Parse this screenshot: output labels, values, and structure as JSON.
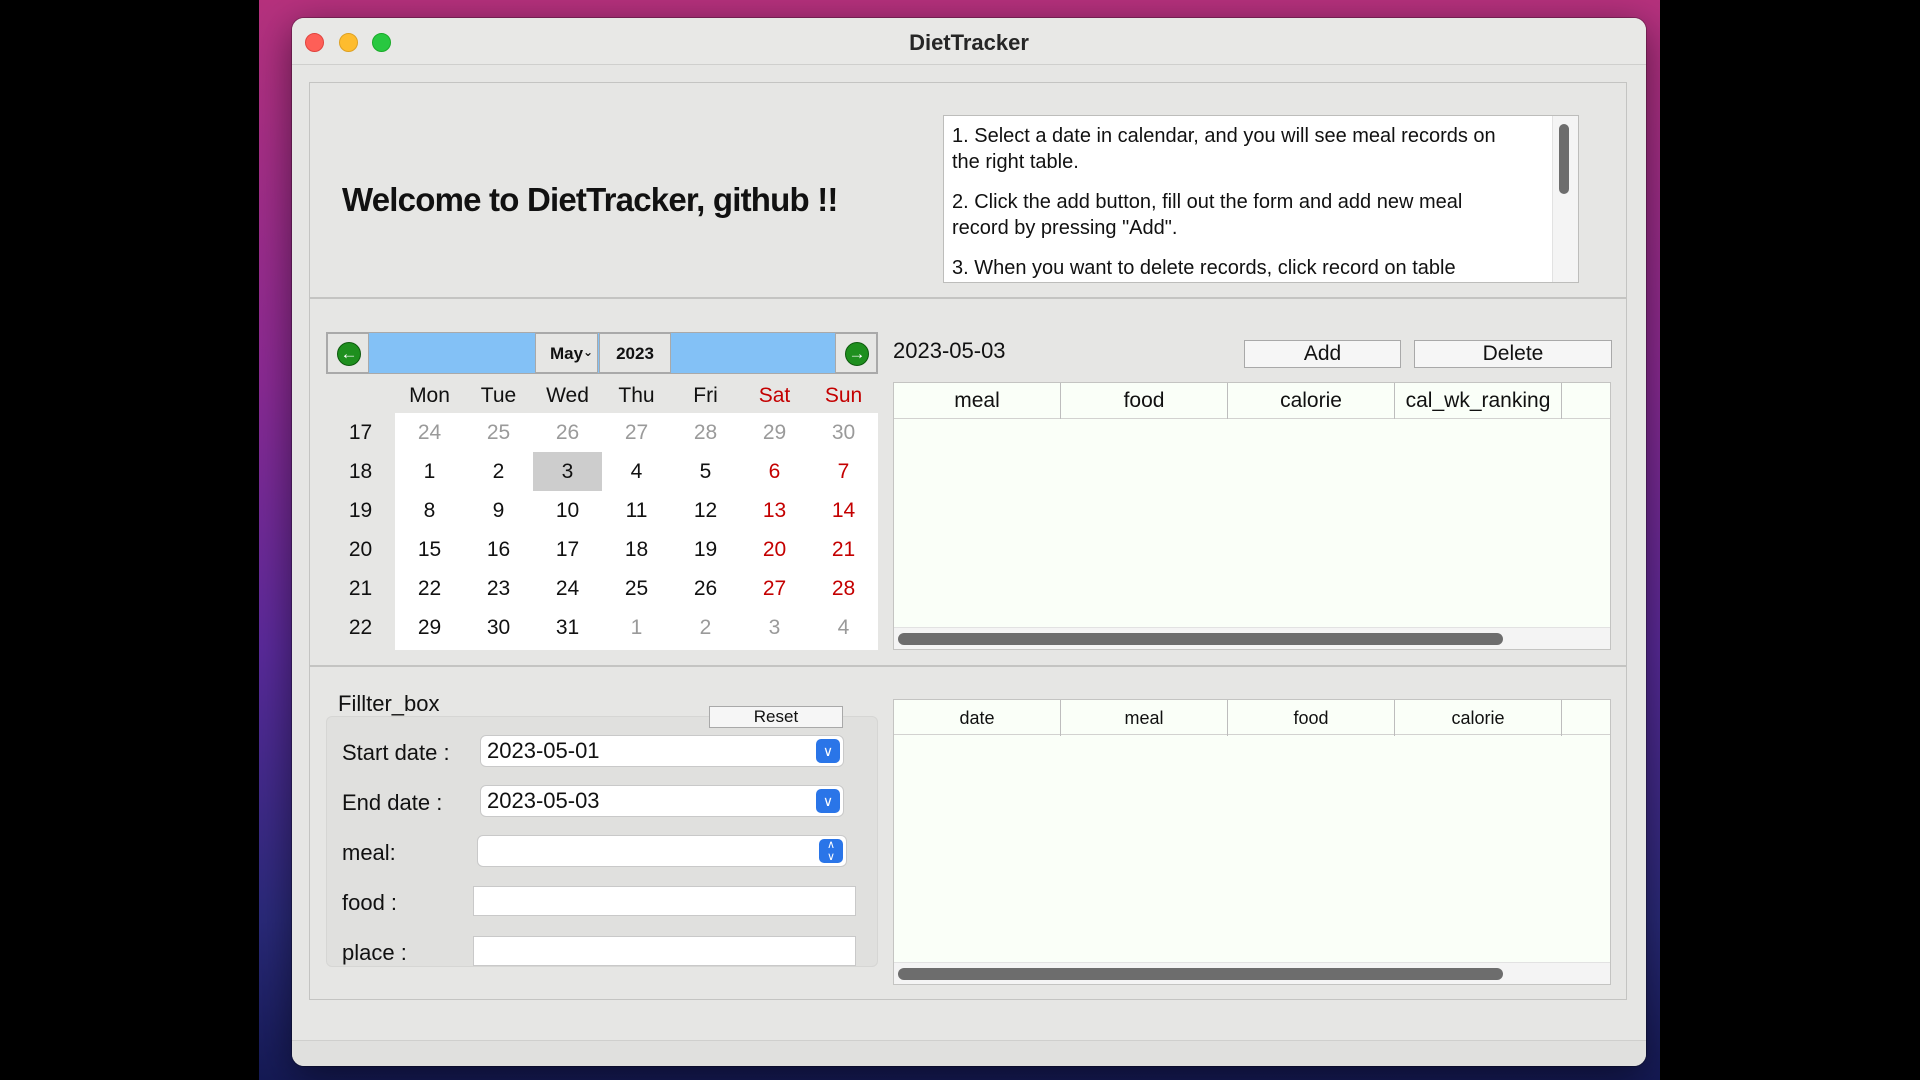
{
  "window": {
    "title": "DietTracker"
  },
  "welcome": "Welcome to DietTracker, github !!",
  "instructions": [
    "1. Select a date in calendar, and you will see meal records on the right table.",
    "2. Click the add button, fill out the form and add new meal record by pressing \"Add\".",
    "3. When you want to delete records, click record on table"
  ],
  "calendar": {
    "month": "May",
    "year": "2023",
    "weekdays": [
      "Mon",
      "Tue",
      "Wed",
      "Thu",
      "Fri",
      "Sat",
      "Sun"
    ],
    "weeks": [
      {
        "no": "17",
        "days": [
          "24",
          "25",
          "26",
          "27",
          "28",
          "29",
          "30"
        ]
      },
      {
        "no": "18",
        "days": [
          "1",
          "2",
          "3",
          "4",
          "5",
          "6",
          "7"
        ]
      },
      {
        "no": "19",
        "days": [
          "8",
          "9",
          "10",
          "11",
          "12",
          "13",
          "14"
        ]
      },
      {
        "no": "20",
        "days": [
          "15",
          "16",
          "17",
          "18",
          "19",
          "20",
          "21"
        ]
      },
      {
        "no": "21",
        "days": [
          "22",
          "23",
          "24",
          "25",
          "26",
          "27",
          "28"
        ]
      },
      {
        "no": "22",
        "days": [
          "29",
          "30",
          "31",
          "1",
          "2",
          "3",
          "4"
        ]
      }
    ],
    "selected": "3"
  },
  "records": {
    "date": "2023-05-03",
    "add_label": "Add",
    "delete_label": "Delete",
    "columns": [
      "meal",
      "food",
      "calorie",
      "cal_wk_ranking"
    ]
  },
  "filter": {
    "title": "Fillter_box",
    "reset_label": "Reset",
    "start_label": "Start date :",
    "start_value": "2023-05-01",
    "end_label": "End date :",
    "end_value": "2023-05-03",
    "meal_label": "meal:",
    "food_label": "food :",
    "place_label": "place :"
  },
  "filter_table": {
    "columns": [
      "date",
      "meal",
      "food",
      "calorie"
    ]
  },
  "colors": {
    "calendar_nav": "#83c1f6",
    "weekend": "#c40000",
    "nav_arrow": "#1e8f1e",
    "dropdown_accent": "#2a75e8"
  }
}
